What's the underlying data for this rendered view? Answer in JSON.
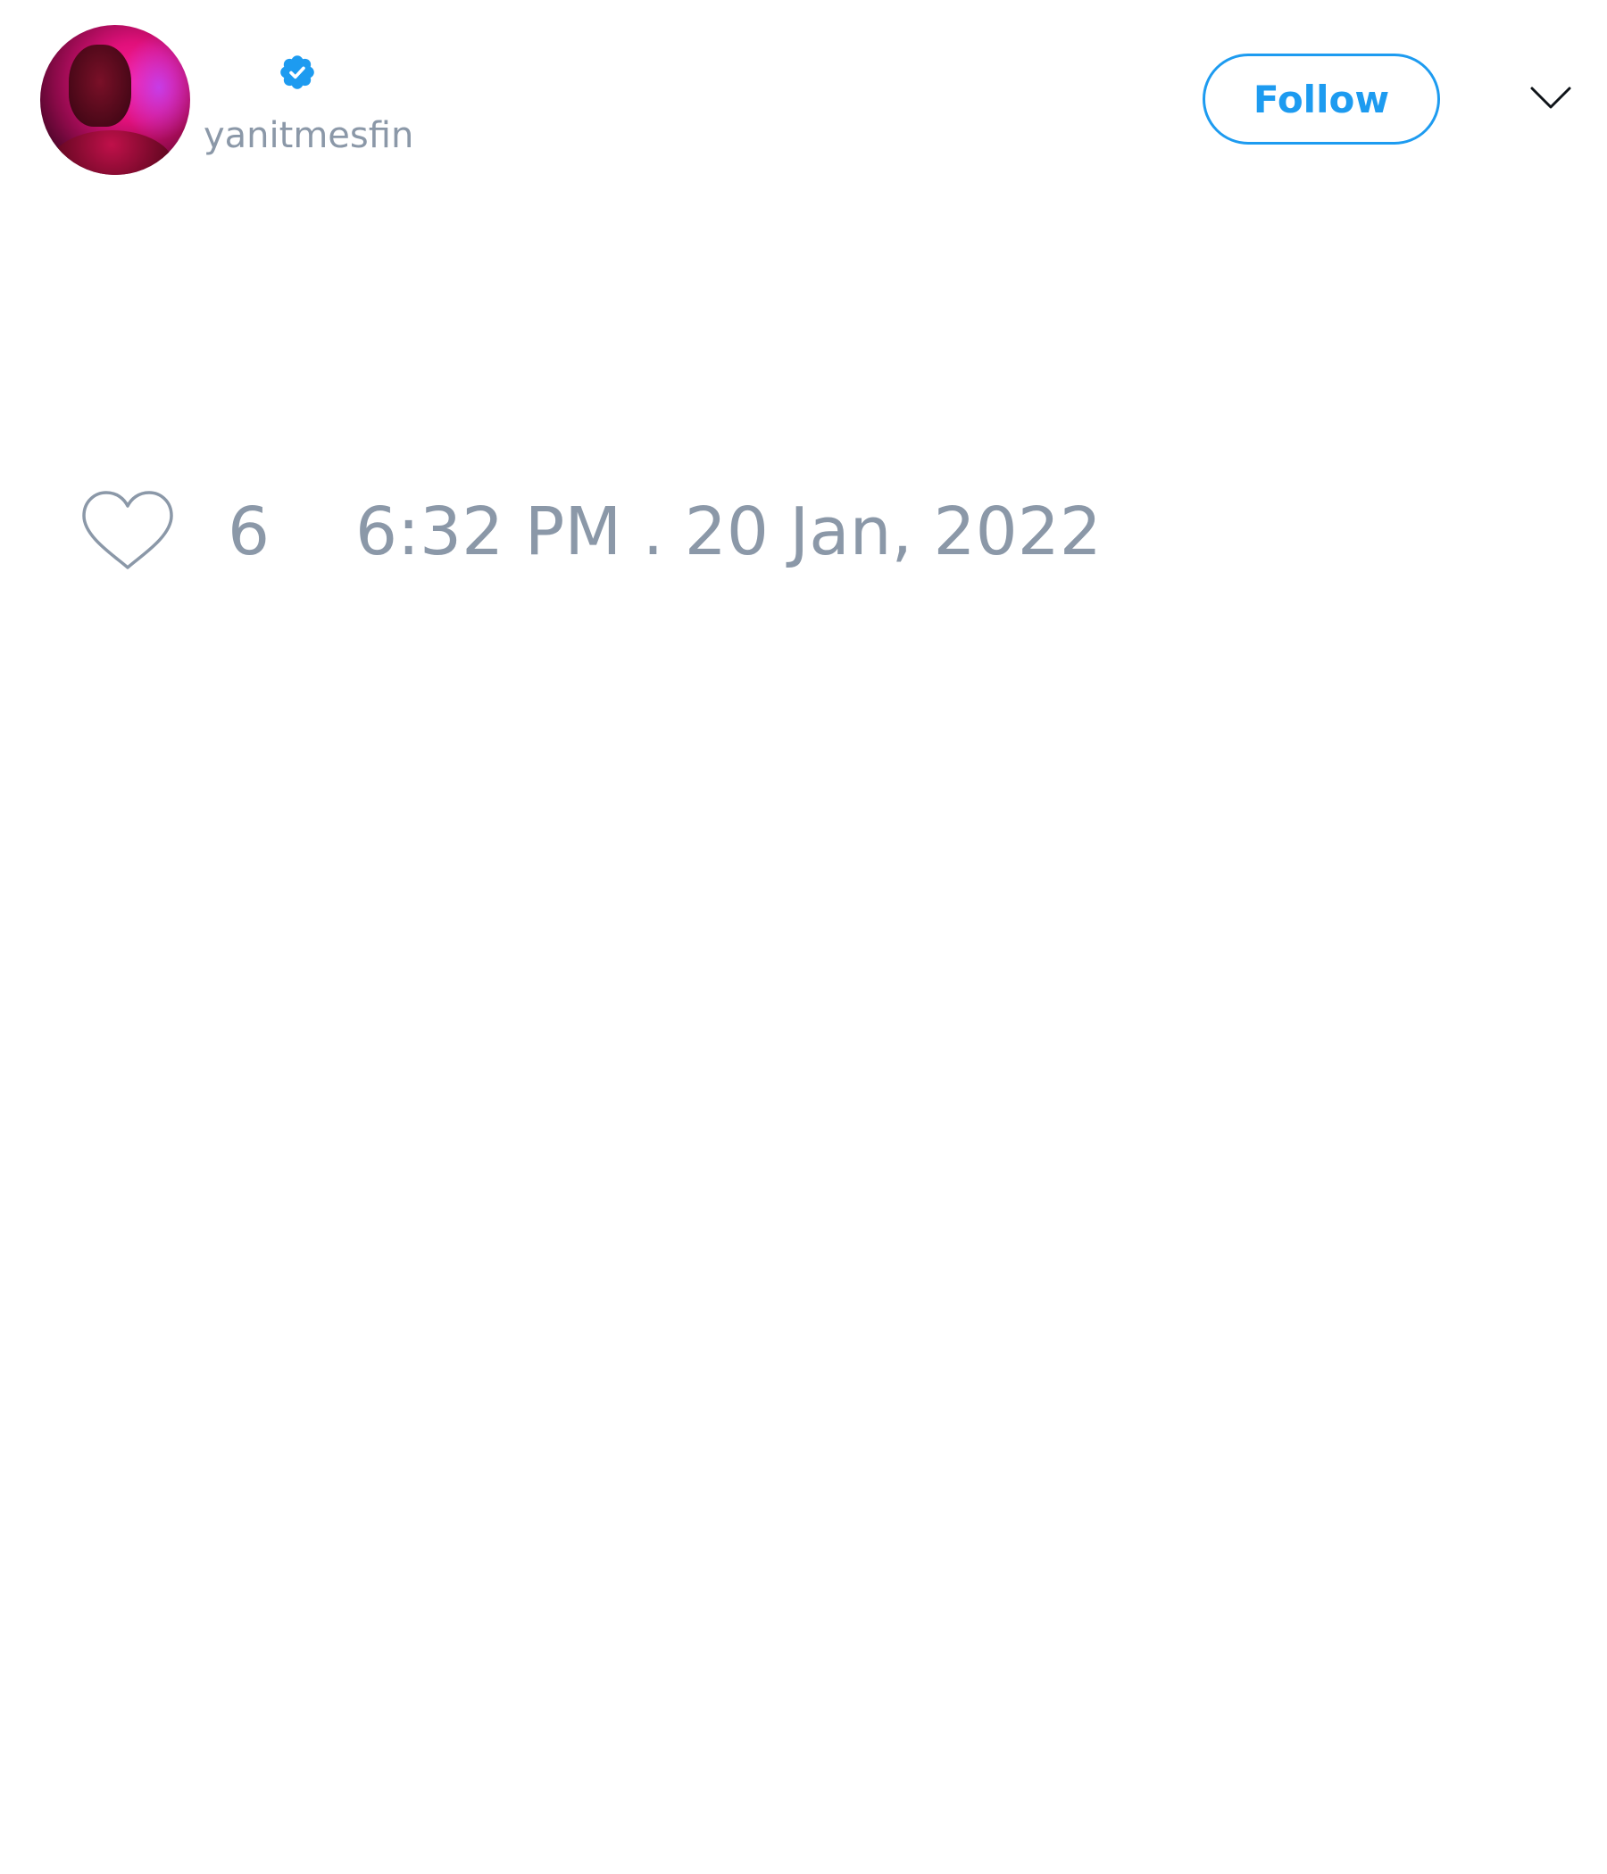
{
  "tweet": {
    "author": {
      "username": "yanitmesfin",
      "verified": true,
      "avatar_icon": "profile-photo"
    },
    "follow_label": "Follow",
    "like_count": "6",
    "timestamp": "6:32 PM . 20 Jan, 2022"
  },
  "colors": {
    "accent": "#1d9bf0",
    "muted_text": "#8b98a8",
    "background": "#ffffff",
    "chevron": "#0f1419"
  },
  "icons": {
    "verified": "verified-badge-icon",
    "menu": "chevron-down-icon",
    "like": "heart-icon"
  }
}
